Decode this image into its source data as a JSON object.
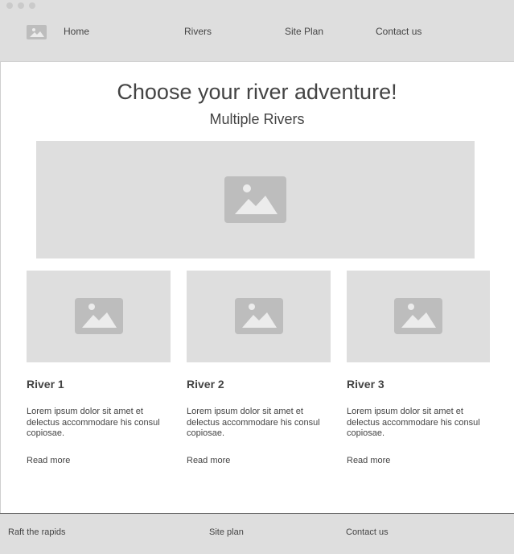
{
  "nav": {
    "home": "Home",
    "rivers": "Rivers",
    "site_plan": "Site Plan",
    "contact": "Contact us"
  },
  "main": {
    "title": "Choose your river adventure!",
    "subtitle": "Multiple Rivers"
  },
  "cards": [
    {
      "title": "River 1",
      "text": "Lorem ipsum dolor sit amet et delectus accommodare his consul copiosae.",
      "link": "Read more"
    },
    {
      "title": "River 2",
      "text": "Lorem ipsum dolor sit amet et delectus accommodare his consul copiosae.",
      "link": "Read more"
    },
    {
      "title": "River 3",
      "text": "Lorem ipsum dolor sit amet et delectus accommodare his consul copiosae.",
      "link": "Read more"
    }
  ],
  "footer": {
    "brand": "Raft the rapids",
    "site_plan": "Site plan",
    "contact": "Contact us"
  },
  "icons": {
    "logo": "image-placeholder-icon",
    "hero": "image-placeholder-icon",
    "card": "image-placeholder-icon"
  },
  "colors": {
    "placeholder_bg": "#dedede",
    "icon": "#bdbdbd",
    "text": "#444444"
  }
}
